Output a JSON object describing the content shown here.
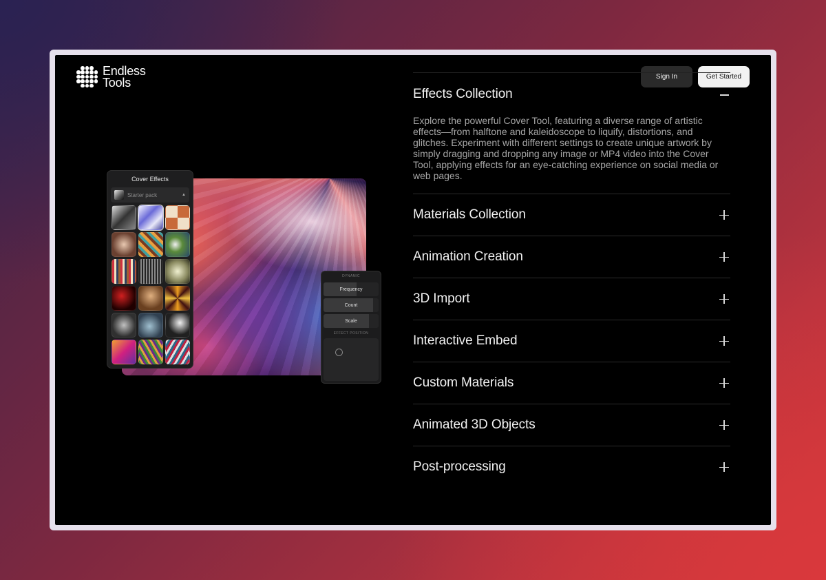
{
  "brand": {
    "line1": "Endless",
    "line2": "Tools"
  },
  "nav": {
    "sign_in": "Sign In",
    "get_started": "Get Started"
  },
  "accordion": {
    "open": {
      "title": "Effects Collection",
      "body": "Explore the powerful Cover Tool, featuring a diverse range of artistic effects—from halftone and kaleidoscope to liquify, distortions, and glitches. Experiment with different settings to create unique artwork by simply dragging and dropping any image or MP4 video into the Cover Tool, applying effects for an eye-catching experience on social media or web pages."
    },
    "items": [
      {
        "title": "Materials Collection"
      },
      {
        "title": "Animation Creation"
      },
      {
        "title": "3D Import"
      },
      {
        "title": "Interactive Embed"
      },
      {
        "title": "Custom Materials"
      },
      {
        "title": "Animated 3D Objects"
      },
      {
        "title": "Post-processing"
      }
    ]
  },
  "showcase": {
    "effects_panel": {
      "title": "Cover Effects",
      "pack": "Starter pack"
    },
    "dynamic_panel": {
      "header": "DYNAMIC",
      "sliders": [
        {
          "label": "Frequency",
          "value": 0.6
        },
        {
          "label": "Count",
          "value": 0.9
        },
        {
          "label": "Scale",
          "value": 0.82
        }
      ],
      "position_header": "EFFECT POSITION"
    }
  },
  "icons": {
    "collapse": "minus-icon",
    "expand": "plus-icon",
    "logo": "dot-grid-logo-icon",
    "dropdown": "caret-up-icon"
  }
}
